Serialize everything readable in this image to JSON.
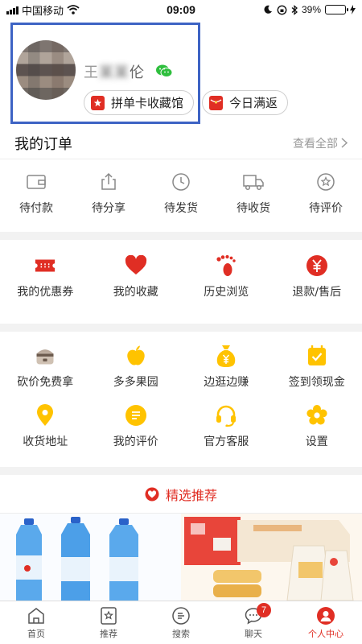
{
  "status_bar": {
    "carrier": "中国移动",
    "time": "09:09",
    "battery": "39%",
    "battery_level": 0.39
  },
  "profile": {
    "nickname_visible": "王",
    "nickname_blurred": "某某",
    "nickname_end": "伦",
    "chips": [
      {
        "label": "拼单卡收藏馆"
      },
      {
        "label": "今日满返"
      }
    ]
  },
  "orders": {
    "title": "我的订单",
    "view_all": "查看全部",
    "items": [
      {
        "label": "待付款",
        "icon": "wallet-icon"
      },
      {
        "label": "待分享",
        "icon": "share-icon"
      },
      {
        "label": "待发货",
        "icon": "clock-icon"
      },
      {
        "label": "待收货",
        "icon": "truck-icon"
      },
      {
        "label": "待评价",
        "icon": "review-icon"
      }
    ]
  },
  "services_a": [
    {
      "label": "我的优惠券",
      "icon": "coupon-icon"
    },
    {
      "label": "我的收藏",
      "icon": "heart-icon"
    },
    {
      "label": "历史浏览",
      "icon": "footprint-icon"
    },
    {
      "label": "退款/售后",
      "icon": "refund-icon"
    }
  ],
  "services_b": [
    {
      "label": "砍价免费拿",
      "icon": "rice-cooker-icon"
    },
    {
      "label": "多多果园",
      "icon": "apple-icon"
    },
    {
      "label": "边逛边赚",
      "icon": "money-bag-icon"
    },
    {
      "label": "签到领现金",
      "icon": "checkin-icon"
    }
  ],
  "services_c": [
    {
      "label": "收货地址",
      "icon": "location-icon"
    },
    {
      "label": "我的评价",
      "icon": "comment-icon"
    },
    {
      "label": "官方客服",
      "icon": "headset-icon"
    },
    {
      "label": "设置",
      "icon": "settings-icon"
    }
  ],
  "recommend": {
    "title": "精选推荐"
  },
  "tab_bar": {
    "items": [
      {
        "label": "首页",
        "icon": "home-icon"
      },
      {
        "label": "推荐",
        "icon": "recommend-icon"
      },
      {
        "label": "搜索",
        "icon": "search-icon"
      },
      {
        "label": "聊天",
        "icon": "chat-icon",
        "badge": "7"
      },
      {
        "label": "个人中心",
        "icon": "profile-icon",
        "active": true
      }
    ]
  },
  "colors": {
    "brand_red": "#e02e24",
    "yellow": "#ffc300",
    "highlight_blue": "#3d63c4"
  }
}
